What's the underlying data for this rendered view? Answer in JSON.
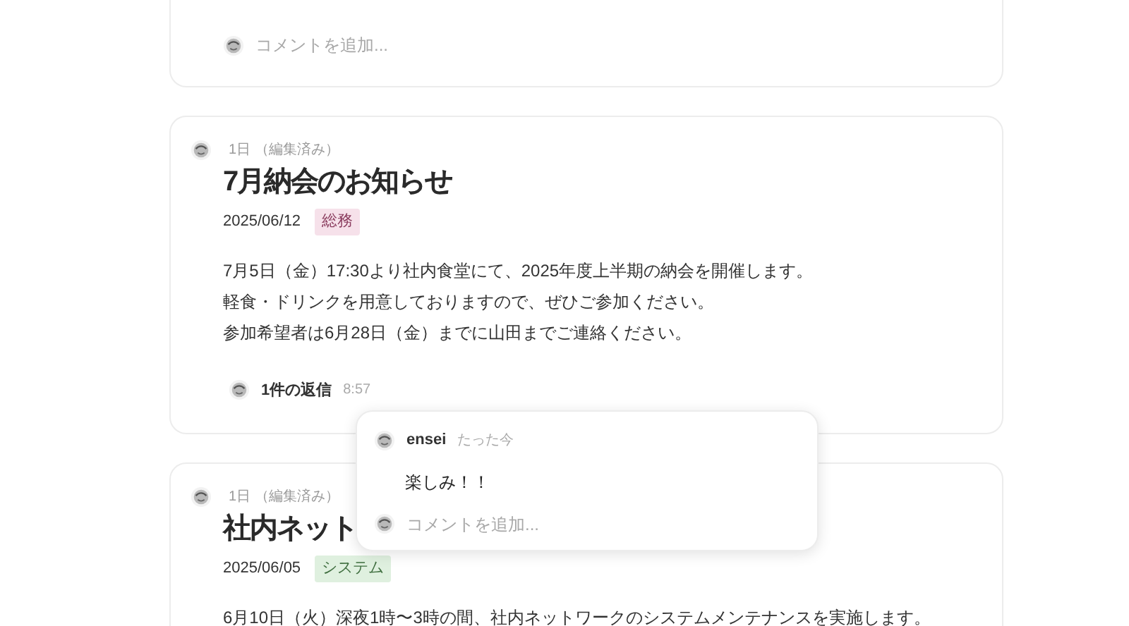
{
  "posts": [
    {
      "comment_placeholder": "コメントを追加..."
    },
    {
      "meta": "1日 （編集済み）",
      "title": "7月納会のお知らせ",
      "date": "2025/06/12",
      "tag": {
        "label": "総務",
        "color": "#f6e1ea"
      },
      "body": [
        "7月5日（金）17:30より社内食堂にて、2025年度上半期の納会を開催します。",
        "軽食・ドリンクを用意しておりますので、ぜひご参加ください。",
        "参加希望者は6月28日（金）までに山田までご連絡ください。"
      ],
      "replies": {
        "label": "1件の返信",
        "time": "8:57"
      }
    },
    {
      "meta": "1日 （編集済み）",
      "title": "社内ネット",
      "date": "2025/06/05",
      "tag": {
        "label": "システム",
        "color": "#dff0df"
      },
      "body": [
        "6月10日（火）深夜1時〜3時の間、社内ネットワークのシステムメンテナンスを実施します。"
      ]
    }
  ],
  "popover": {
    "author": "ensei",
    "time": "たった今",
    "message": "楽しみ！！",
    "comment_placeholder": "コメントを追加..."
  }
}
